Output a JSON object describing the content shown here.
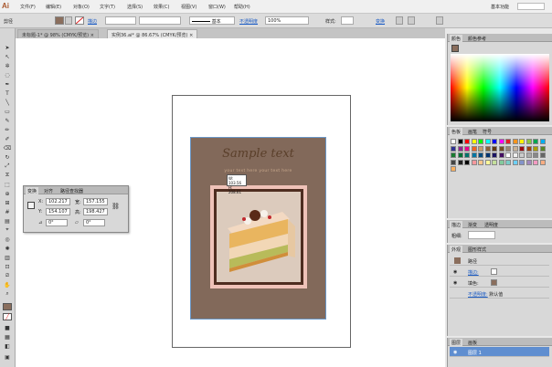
{
  "app": {
    "logo": "Ai",
    "workspace": "基本功能"
  },
  "menu": [
    "文件(F)",
    "编辑(E)",
    "对象(O)",
    "文字(T)",
    "选择(S)",
    "效果(C)",
    "视图(V)",
    "窗口(W)",
    "帮助(H)"
  ],
  "control_bar": {
    "selection_label": "剪径",
    "stroke_label": "描边",
    "brush_label": "基本",
    "opacity_label": "不透明度",
    "opacity_value": "100%",
    "style_label": "样式:",
    "transform_link": "变换"
  },
  "tabs": [
    {
      "label": "未标题-1* @ 98% (CMYK/预览)"
    },
    {
      "label": "实例36.ai* @ 86.67% (CMYK/预览)"
    }
  ],
  "artwork": {
    "title": "Sample text",
    "subtitle": "your text here your text here",
    "poster_bg": "#82695a",
    "frame_color": "#efc2b8",
    "tooltip_w": "W: 103.56",
    "tooltip_h": "H: 208.61"
  },
  "transform_panel": {
    "tabs": [
      "变换",
      "对齐",
      "路径查找器"
    ],
    "x_label": "X:",
    "x_value": "102.217",
    "y_label": "Y:",
    "y_value": "154.107",
    "w_label": "宽:",
    "w_value": "157.155",
    "h_label": "高:",
    "h_value": "198.427",
    "angle_value": "0°",
    "shear_value": "0°"
  },
  "color_panel": {
    "tabs": [
      "颜色",
      "颜色参考"
    ]
  },
  "swatch_panel": {
    "tabs": [
      "色板",
      "画笔",
      "符号"
    ]
  },
  "stroke_panel": {
    "tabs": [
      "描边",
      "渐变",
      "透明度"
    ],
    "weight_label": "粗细:"
  },
  "appearance_panel": {
    "tabs": [
      "外观",
      "图形样式"
    ],
    "rows": [
      {
        "label": "路径"
      },
      {
        "label": "描边:"
      },
      {
        "label": "填色:"
      },
      {
        "label": "不透明度:",
        "value": "默认值"
      }
    ]
  },
  "layers_panel": {
    "tabs": [
      "图层",
      "画板"
    ],
    "layer_name": "图层 1"
  },
  "colors": {
    "swatches": [
      "#ffffff",
      "#000000",
      "#ff0000",
      "#ffff00",
      "#00ff00",
      "#00ffff",
      "#0000ff",
      "#ff00ff",
      "#e61e25",
      "#f7941d",
      "#fff200",
      "#8dc63f",
      "#00a651",
      "#00aeef",
      "#2e3192",
      "#92278f",
      "#ec008c",
      "#f26522",
      "#c69c6d",
      "#8c6239",
      "#603913",
      "#754c24",
      "#998675",
      "#c7b299",
      "#9e0b0f",
      "#a0410d",
      "#aba000",
      "#598527",
      "#1a7b30",
      "#007236",
      "#00746b",
      "#0076a3",
      "#004b80",
      "#003471",
      "#1b1464",
      "#440e62",
      "#ffffff",
      "#eeeeee",
      "#cccccc",
      "#aaaaaa",
      "#888888",
      "#666666",
      "#444444",
      "#222222",
      "#000000",
      "#f5989d",
      "#fdc68a",
      "#fff799",
      "#c4df9b",
      "#82ca9c",
      "#7accc8",
      "#6dcff6",
      "#8393ca",
      "#a187be",
      "#f49ac1",
      "#f9ad81",
      "#fbaf5d"
    ]
  }
}
